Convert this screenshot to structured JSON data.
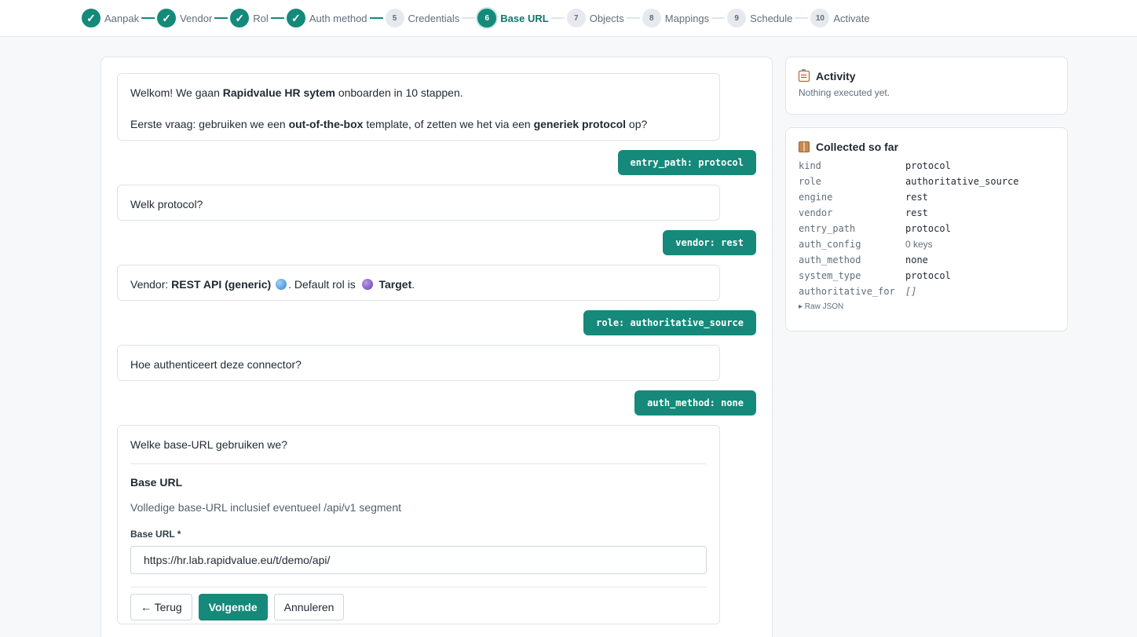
{
  "stepper": {
    "steps": [
      {
        "num": "1",
        "label": "Aanpak",
        "state": "done"
      },
      {
        "num": "2",
        "label": "Vendor",
        "state": "done"
      },
      {
        "num": "3",
        "label": "Rol",
        "state": "done"
      },
      {
        "num": "4",
        "label": "Auth method",
        "state": "done"
      },
      {
        "num": "5",
        "label": "Credentials",
        "state": "todo"
      },
      {
        "num": "6",
        "label": "Base URL",
        "state": "current"
      },
      {
        "num": "7",
        "label": "Objects",
        "state": "todo"
      },
      {
        "num": "8",
        "label": "Mappings",
        "state": "todo"
      },
      {
        "num": "9",
        "label": "Schedule",
        "state": "todo"
      },
      {
        "num": "10",
        "label": "Activate",
        "state": "todo"
      }
    ],
    "check_glyph": "✓"
  },
  "chat": {
    "msg1": {
      "line1_pre": "Welkom! We gaan ",
      "line1_bold": "Rapidvalue HR sytem",
      "line1_post": " onboarden in 10 stappen.",
      "line2_pre": "Eerste vraag: gebruiken we een ",
      "line2_bold1": "out-of-the-box",
      "line2_mid": " template, of zetten we het via een ",
      "line2_bold2": "generiek protocol",
      "line2_post": " op?"
    },
    "reply1": "entry_path: protocol",
    "msg2": "Welk protocol?",
    "reply2": "vendor: rest",
    "msg3": {
      "pre": "Vendor: ",
      "bold": "REST API (generic)",
      "mid": ". Default rol is ",
      "role_bold": "Target",
      "post": "."
    },
    "reply3": "role: authoritative_source",
    "msg4": "Hoe authenticeert deze connector?",
    "reply4": "auth_method: none",
    "form": {
      "question": "Welke base-URL gebruiken we?",
      "title": "Base URL",
      "description": "Volledige base-URL inclusief eventueel /api/v1 segment",
      "field_label": "Base URL *",
      "field_value": "https://hr.lab.rapidvalue.eu/t/demo/api/",
      "back_label": "← Terug",
      "next_label": "Volgende",
      "cancel_label": "Annuleren"
    }
  },
  "activity": {
    "title": "Activity",
    "empty_text": "Nothing executed yet."
  },
  "collected": {
    "title": "Collected so far",
    "rows": [
      {
        "key": "kind",
        "value": "protocol",
        "style": "normal"
      },
      {
        "key": "role",
        "value": "authoritative_source",
        "style": "normal"
      },
      {
        "key": "engine",
        "value": "rest",
        "style": "normal"
      },
      {
        "key": "vendor",
        "value": "rest",
        "style": "normal"
      },
      {
        "key": "entry_path",
        "value": "protocol",
        "style": "normal"
      },
      {
        "key": "auth_config",
        "value": "0 keys",
        "style": "dim"
      },
      {
        "key": "auth_method",
        "value": "none",
        "style": "normal"
      },
      {
        "key": "system_type",
        "value": "protocol",
        "style": "normal"
      },
      {
        "key": "authoritative_for",
        "value": "[]",
        "style": "ital"
      }
    ],
    "raw_json_label": "▸ Raw JSON"
  },
  "colors": {
    "accent": "#15897a",
    "accent_dark": "#0f766e"
  }
}
